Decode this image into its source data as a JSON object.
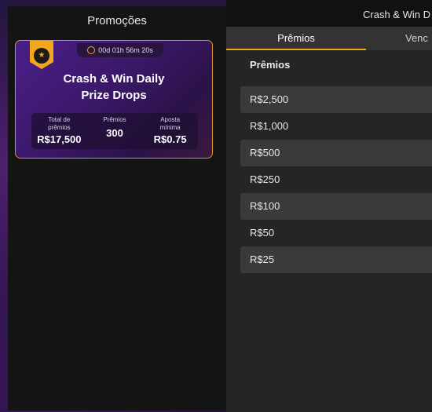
{
  "left": {
    "title": "Promoções",
    "card": {
      "badge_text": "★",
      "timer": "00d 01h 56m 20s",
      "title_line1": "Crash & Win Daily",
      "title_line2": "Prize Drops",
      "stats": [
        {
          "label_line1": "Total de",
          "label_line2": "prêmios",
          "value": "R$17,500"
        },
        {
          "label_line1": "Prêmios",
          "label_line2": "",
          "value": "300"
        },
        {
          "label_line1": "Aposta",
          "label_line2": "mínima",
          "value": "R$0.75"
        }
      ]
    }
  },
  "right": {
    "title": "Crash & Win D",
    "tabs": [
      {
        "label": "Prêmios"
      },
      {
        "label": "Venc"
      }
    ],
    "section_title": "Prêmios",
    "prizes": [
      "R$2,500",
      "R$1,000",
      "R$500",
      "R$250",
      "R$100",
      "R$50",
      "R$25"
    ]
  }
}
